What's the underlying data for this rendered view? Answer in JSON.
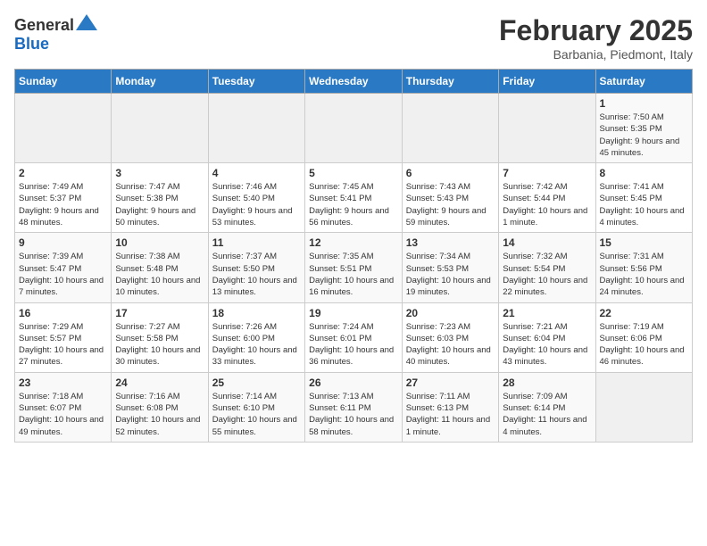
{
  "header": {
    "logo_general": "General",
    "logo_blue": "Blue",
    "month_year": "February 2025",
    "subtitle": "Barbania, Piedmont, Italy"
  },
  "weekdays": [
    "Sunday",
    "Monday",
    "Tuesday",
    "Wednesday",
    "Thursday",
    "Friday",
    "Saturday"
  ],
  "weeks": [
    [
      {
        "day": "",
        "info": "",
        "empty": true
      },
      {
        "day": "",
        "info": "",
        "empty": true
      },
      {
        "day": "",
        "info": "",
        "empty": true
      },
      {
        "day": "",
        "info": "",
        "empty": true
      },
      {
        "day": "",
        "info": "",
        "empty": true
      },
      {
        "day": "",
        "info": "",
        "empty": true
      },
      {
        "day": "1",
        "info": "Sunrise: 7:50 AM\nSunset: 5:35 PM\nDaylight: 9 hours and 45 minutes.",
        "empty": false
      }
    ],
    [
      {
        "day": "2",
        "info": "Sunrise: 7:49 AM\nSunset: 5:37 PM\nDaylight: 9 hours and 48 minutes.",
        "empty": false
      },
      {
        "day": "3",
        "info": "Sunrise: 7:47 AM\nSunset: 5:38 PM\nDaylight: 9 hours and 50 minutes.",
        "empty": false
      },
      {
        "day": "4",
        "info": "Sunrise: 7:46 AM\nSunset: 5:40 PM\nDaylight: 9 hours and 53 minutes.",
        "empty": false
      },
      {
        "day": "5",
        "info": "Sunrise: 7:45 AM\nSunset: 5:41 PM\nDaylight: 9 hours and 56 minutes.",
        "empty": false
      },
      {
        "day": "6",
        "info": "Sunrise: 7:43 AM\nSunset: 5:43 PM\nDaylight: 9 hours and 59 minutes.",
        "empty": false
      },
      {
        "day": "7",
        "info": "Sunrise: 7:42 AM\nSunset: 5:44 PM\nDaylight: 10 hours and 1 minute.",
        "empty": false
      },
      {
        "day": "8",
        "info": "Sunrise: 7:41 AM\nSunset: 5:45 PM\nDaylight: 10 hours and 4 minutes.",
        "empty": false
      }
    ],
    [
      {
        "day": "9",
        "info": "Sunrise: 7:39 AM\nSunset: 5:47 PM\nDaylight: 10 hours and 7 minutes.",
        "empty": false
      },
      {
        "day": "10",
        "info": "Sunrise: 7:38 AM\nSunset: 5:48 PM\nDaylight: 10 hours and 10 minutes.",
        "empty": false
      },
      {
        "day": "11",
        "info": "Sunrise: 7:37 AM\nSunset: 5:50 PM\nDaylight: 10 hours and 13 minutes.",
        "empty": false
      },
      {
        "day": "12",
        "info": "Sunrise: 7:35 AM\nSunset: 5:51 PM\nDaylight: 10 hours and 16 minutes.",
        "empty": false
      },
      {
        "day": "13",
        "info": "Sunrise: 7:34 AM\nSunset: 5:53 PM\nDaylight: 10 hours and 19 minutes.",
        "empty": false
      },
      {
        "day": "14",
        "info": "Sunrise: 7:32 AM\nSunset: 5:54 PM\nDaylight: 10 hours and 22 minutes.",
        "empty": false
      },
      {
        "day": "15",
        "info": "Sunrise: 7:31 AM\nSunset: 5:56 PM\nDaylight: 10 hours and 24 minutes.",
        "empty": false
      }
    ],
    [
      {
        "day": "16",
        "info": "Sunrise: 7:29 AM\nSunset: 5:57 PM\nDaylight: 10 hours and 27 minutes.",
        "empty": false
      },
      {
        "day": "17",
        "info": "Sunrise: 7:27 AM\nSunset: 5:58 PM\nDaylight: 10 hours and 30 minutes.",
        "empty": false
      },
      {
        "day": "18",
        "info": "Sunrise: 7:26 AM\nSunset: 6:00 PM\nDaylight: 10 hours and 33 minutes.",
        "empty": false
      },
      {
        "day": "19",
        "info": "Sunrise: 7:24 AM\nSunset: 6:01 PM\nDaylight: 10 hours and 36 minutes.",
        "empty": false
      },
      {
        "day": "20",
        "info": "Sunrise: 7:23 AM\nSunset: 6:03 PM\nDaylight: 10 hours and 40 minutes.",
        "empty": false
      },
      {
        "day": "21",
        "info": "Sunrise: 7:21 AM\nSunset: 6:04 PM\nDaylight: 10 hours and 43 minutes.",
        "empty": false
      },
      {
        "day": "22",
        "info": "Sunrise: 7:19 AM\nSunset: 6:06 PM\nDaylight: 10 hours and 46 minutes.",
        "empty": false
      }
    ],
    [
      {
        "day": "23",
        "info": "Sunrise: 7:18 AM\nSunset: 6:07 PM\nDaylight: 10 hours and 49 minutes.",
        "empty": false
      },
      {
        "day": "24",
        "info": "Sunrise: 7:16 AM\nSunset: 6:08 PM\nDaylight: 10 hours and 52 minutes.",
        "empty": false
      },
      {
        "day": "25",
        "info": "Sunrise: 7:14 AM\nSunset: 6:10 PM\nDaylight: 10 hours and 55 minutes.",
        "empty": false
      },
      {
        "day": "26",
        "info": "Sunrise: 7:13 AM\nSunset: 6:11 PM\nDaylight: 10 hours and 58 minutes.",
        "empty": false
      },
      {
        "day": "27",
        "info": "Sunrise: 7:11 AM\nSunset: 6:13 PM\nDaylight: 11 hours and 1 minute.",
        "empty": false
      },
      {
        "day": "28",
        "info": "Sunrise: 7:09 AM\nSunset: 6:14 PM\nDaylight: 11 hours and 4 minutes.",
        "empty": false
      },
      {
        "day": "",
        "info": "",
        "empty": true
      }
    ]
  ]
}
